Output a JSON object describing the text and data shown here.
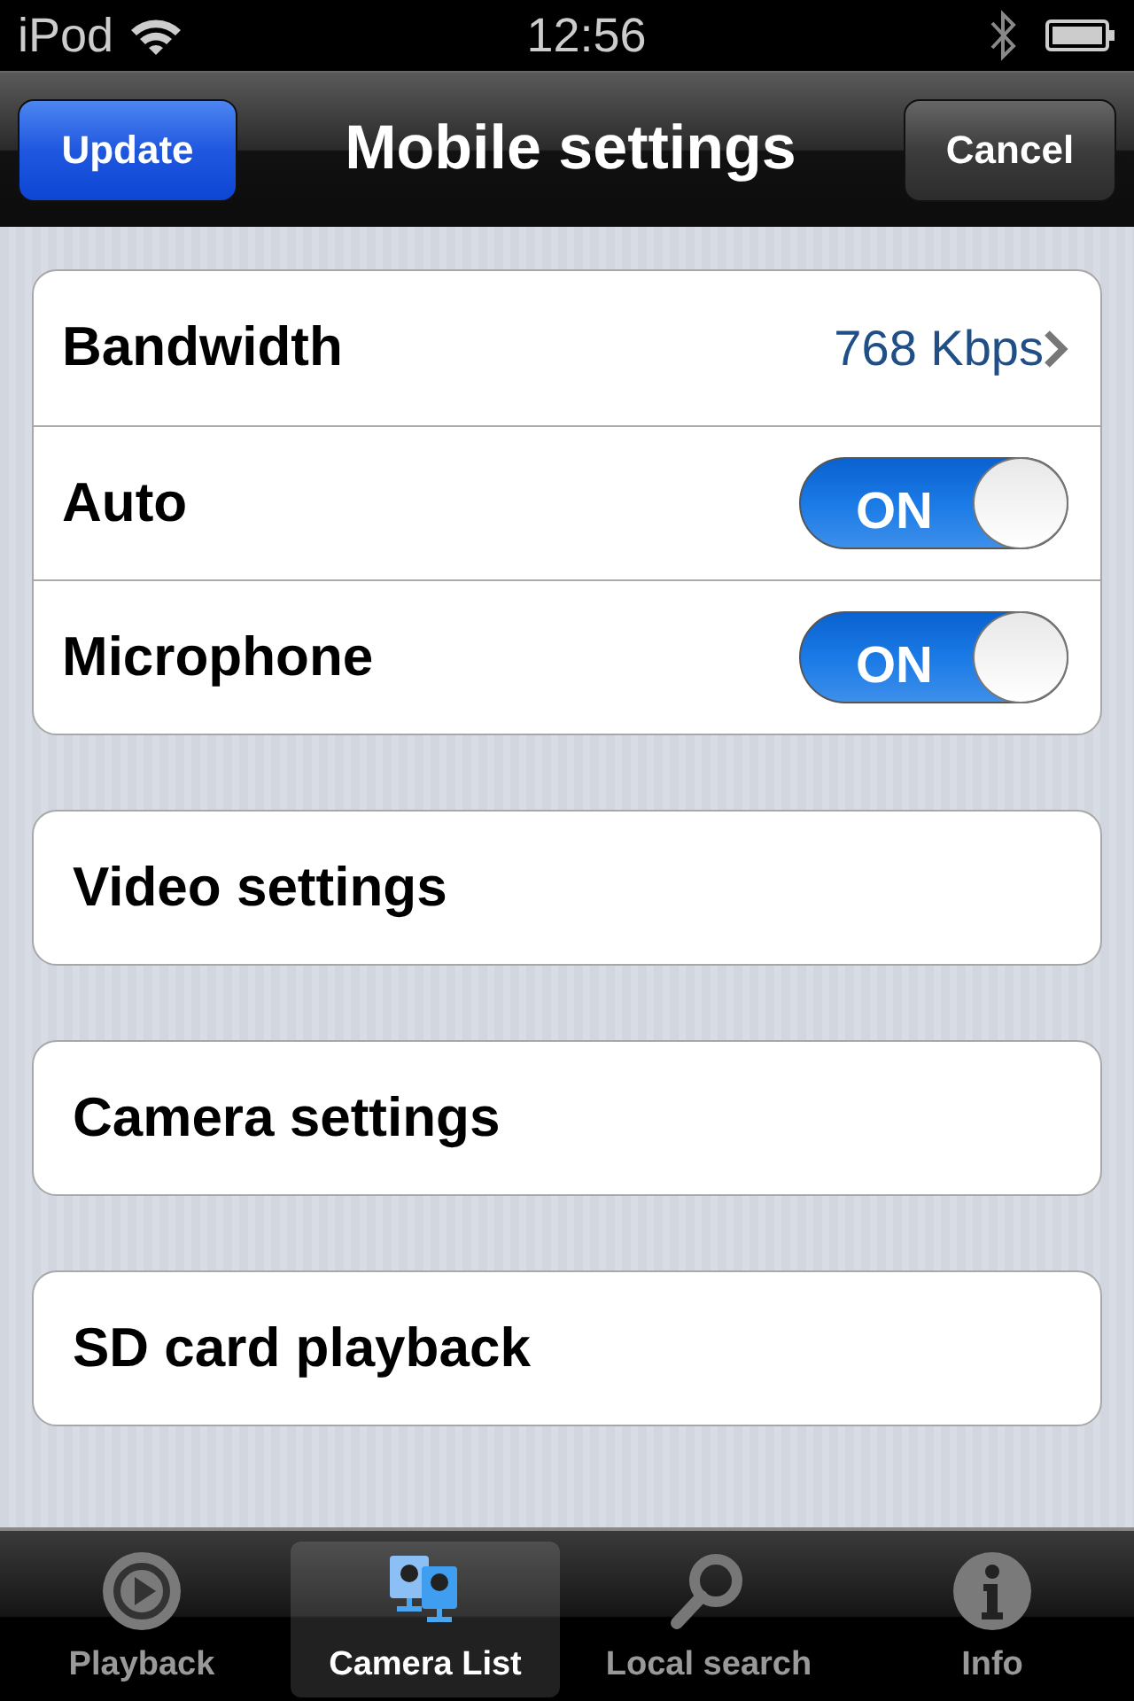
{
  "status_bar": {
    "carrier": "iPod",
    "time": "12:56"
  },
  "nav_bar": {
    "title": "Mobile settings",
    "left_button": "Update",
    "right_button": "Cancel"
  },
  "groups": [
    {
      "rows": [
        {
          "kind": "value",
          "label": "Bandwidth",
          "value": "768 Kbps"
        },
        {
          "kind": "toggle",
          "label": "Auto",
          "on": true,
          "toggle_text": "ON"
        },
        {
          "kind": "toggle",
          "label": "Microphone",
          "on": true,
          "toggle_text": "ON"
        }
      ]
    },
    {
      "rows": [
        {
          "kind": "link",
          "label": "Video settings"
        }
      ]
    },
    {
      "rows": [
        {
          "kind": "link",
          "label": "Camera settings"
        }
      ]
    },
    {
      "rows": [
        {
          "kind": "link",
          "label": "SD card playback"
        }
      ]
    }
  ],
  "tab_bar": [
    {
      "label": "Playback",
      "kind": "playback",
      "selected": false
    },
    {
      "label": "Camera List",
      "kind": "cameras",
      "selected": true
    },
    {
      "label": "Local search",
      "kind": "search",
      "selected": false
    },
    {
      "label": "Info",
      "kind": "info",
      "selected": false
    }
  ]
}
